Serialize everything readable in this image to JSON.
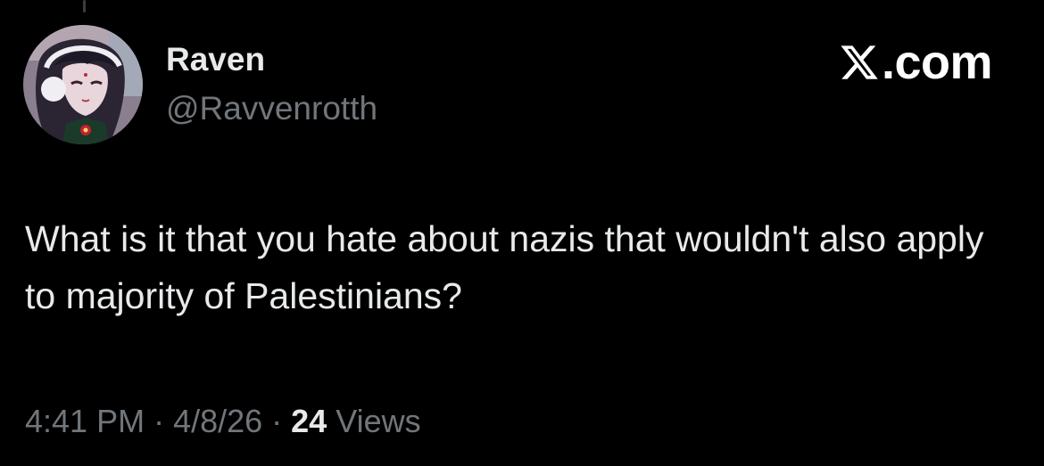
{
  "tweet": {
    "author": {
      "display_name": "Raven",
      "handle": "@Ravvenrotth"
    },
    "brand_label": ".com",
    "brand_icon": "x-logo-icon",
    "text": "What is it that you hate about nazis that wouldn't also apply to majority of Palestinians?",
    "meta": {
      "time": "4:41 PM",
      "separator": "·",
      "date": "4/8/26",
      "views_count": "24",
      "views_label": "Views"
    }
  },
  "colors": {
    "background": "#000000",
    "primary_text": "#e7e9ea",
    "secondary_text": "#71767b",
    "brand_text": "#ffffff"
  }
}
